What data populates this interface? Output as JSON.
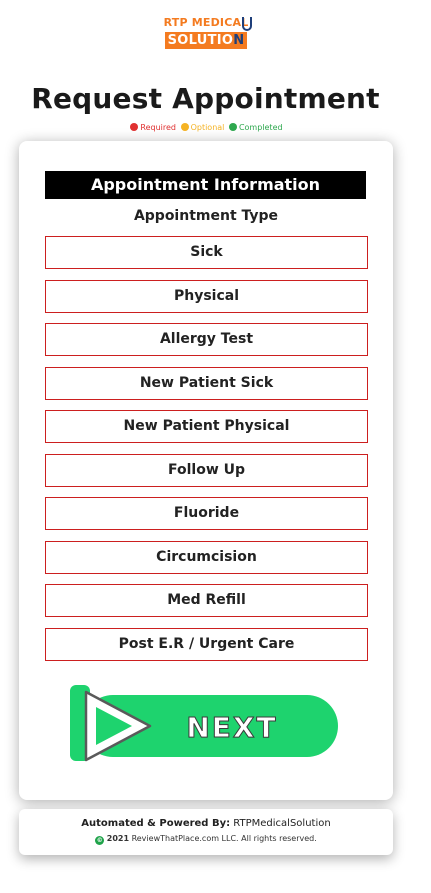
{
  "logo": {
    "top_text": "RTP MEDICAL",
    "bottom_text": "SOLUTIO",
    "bottom_last": "N"
  },
  "page": {
    "title": "Request Appointment"
  },
  "legend": {
    "required_label": "Required",
    "optional_label": "Optional",
    "completed_label": "Completed",
    "required_color": "#e03131",
    "optional_color": "#f5b324",
    "completed_color": "#2fa84f"
  },
  "form": {
    "section_title": "Appointment Information",
    "field_label": "Appointment Type",
    "options": [
      "Sick",
      "Physical",
      "Allergy Test",
      "New Patient Sick",
      "New Patient Physical",
      "Follow Up",
      "Fluoride",
      "Circumcision",
      "Med Refill",
      "Post E.R / Urgent Care"
    ],
    "next_label": "NEXT"
  },
  "footer": {
    "powered_prefix": "Automated & Powered By:",
    "powered_name": "RTPMedicalSolution",
    "copyright_year": "2021",
    "copyright_text": "ReviewThatPlace.com LLC. All rights reserved."
  }
}
